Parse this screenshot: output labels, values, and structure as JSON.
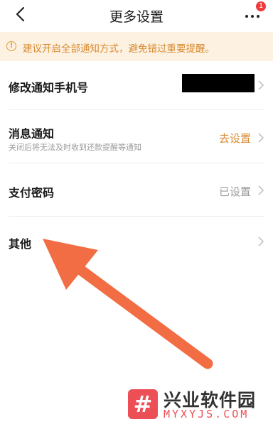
{
  "header": {
    "title": "更多设置",
    "badge_count": "1",
    "back_icon": "chevron-left-icon",
    "more_icon": "more-dots-icon"
  },
  "notice": {
    "text": "建议开启全部通知方式，避免错过重要提醒。",
    "icon": "warning-circle-icon",
    "color": "#d98a2f"
  },
  "rows": [
    {
      "label": "修改通知手机号",
      "value": ""
    },
    {
      "label": "消息通知",
      "sub": "关闭后将无法及时收到还款提醒等通知",
      "value": "去设置"
    },
    {
      "label": "支付密码",
      "value": "已设置"
    },
    {
      "label": "其他",
      "value": ""
    }
  ],
  "colors": {
    "accent": "#d98a2f",
    "arrow": "#f26d43",
    "badge": "#ee3c3c"
  },
  "watermark": {
    "logo_glyph": "#",
    "name": "兴业软件园",
    "url": "MYXYJS.COM"
  }
}
